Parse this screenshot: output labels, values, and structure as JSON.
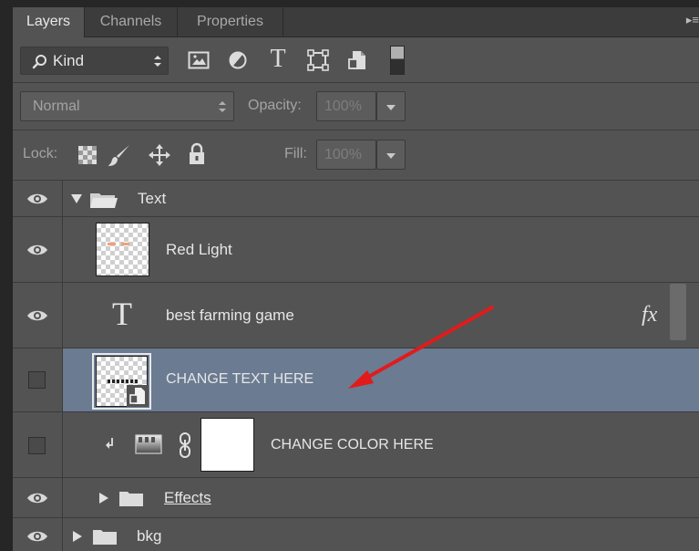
{
  "tabs": [
    {
      "label": "Layers",
      "active": true
    },
    {
      "label": "Channels",
      "active": false
    },
    {
      "label": "Properties",
      "active": false
    }
  ],
  "filter": {
    "kind_label": "Kind",
    "icons": [
      "image-filter-icon",
      "adjustment-filter-icon",
      "type-filter-icon",
      "shape-filter-icon",
      "smart-object-filter-icon",
      "filter-toggle-icon"
    ]
  },
  "type_filter_glyph": "T",
  "blend": {
    "mode": "Normal",
    "opacity_label": "Opacity:",
    "opacity_value": "100%"
  },
  "lock": {
    "label": "Lock:",
    "fill_label": "Fill:",
    "fill_value": "100%"
  },
  "layers": [
    {
      "name": "Text",
      "kind": "group",
      "visible": true,
      "expanded": true
    },
    {
      "name": "Red Light",
      "kind": "pixel",
      "visible": true
    },
    {
      "name": "best farming game",
      "kind": "type",
      "visible": true,
      "fx": "fx",
      "type_glyph": "T"
    },
    {
      "name": "CHANGE TEXT HERE",
      "kind": "smart-object",
      "visible": false,
      "selected": true
    },
    {
      "name": "CHANGE COLOR HERE",
      "kind": "gradient-fill",
      "visible": false,
      "clipped": true
    },
    {
      "name": "Effects",
      "kind": "group",
      "visible": true,
      "expanded": false
    },
    {
      "name": "bkg",
      "kind": "group",
      "visible": true,
      "expanded": false
    }
  ],
  "colors": {
    "panel": "#535353",
    "selected_row": "#6a7b92",
    "annotation_arrow": "#e11b1b"
  }
}
